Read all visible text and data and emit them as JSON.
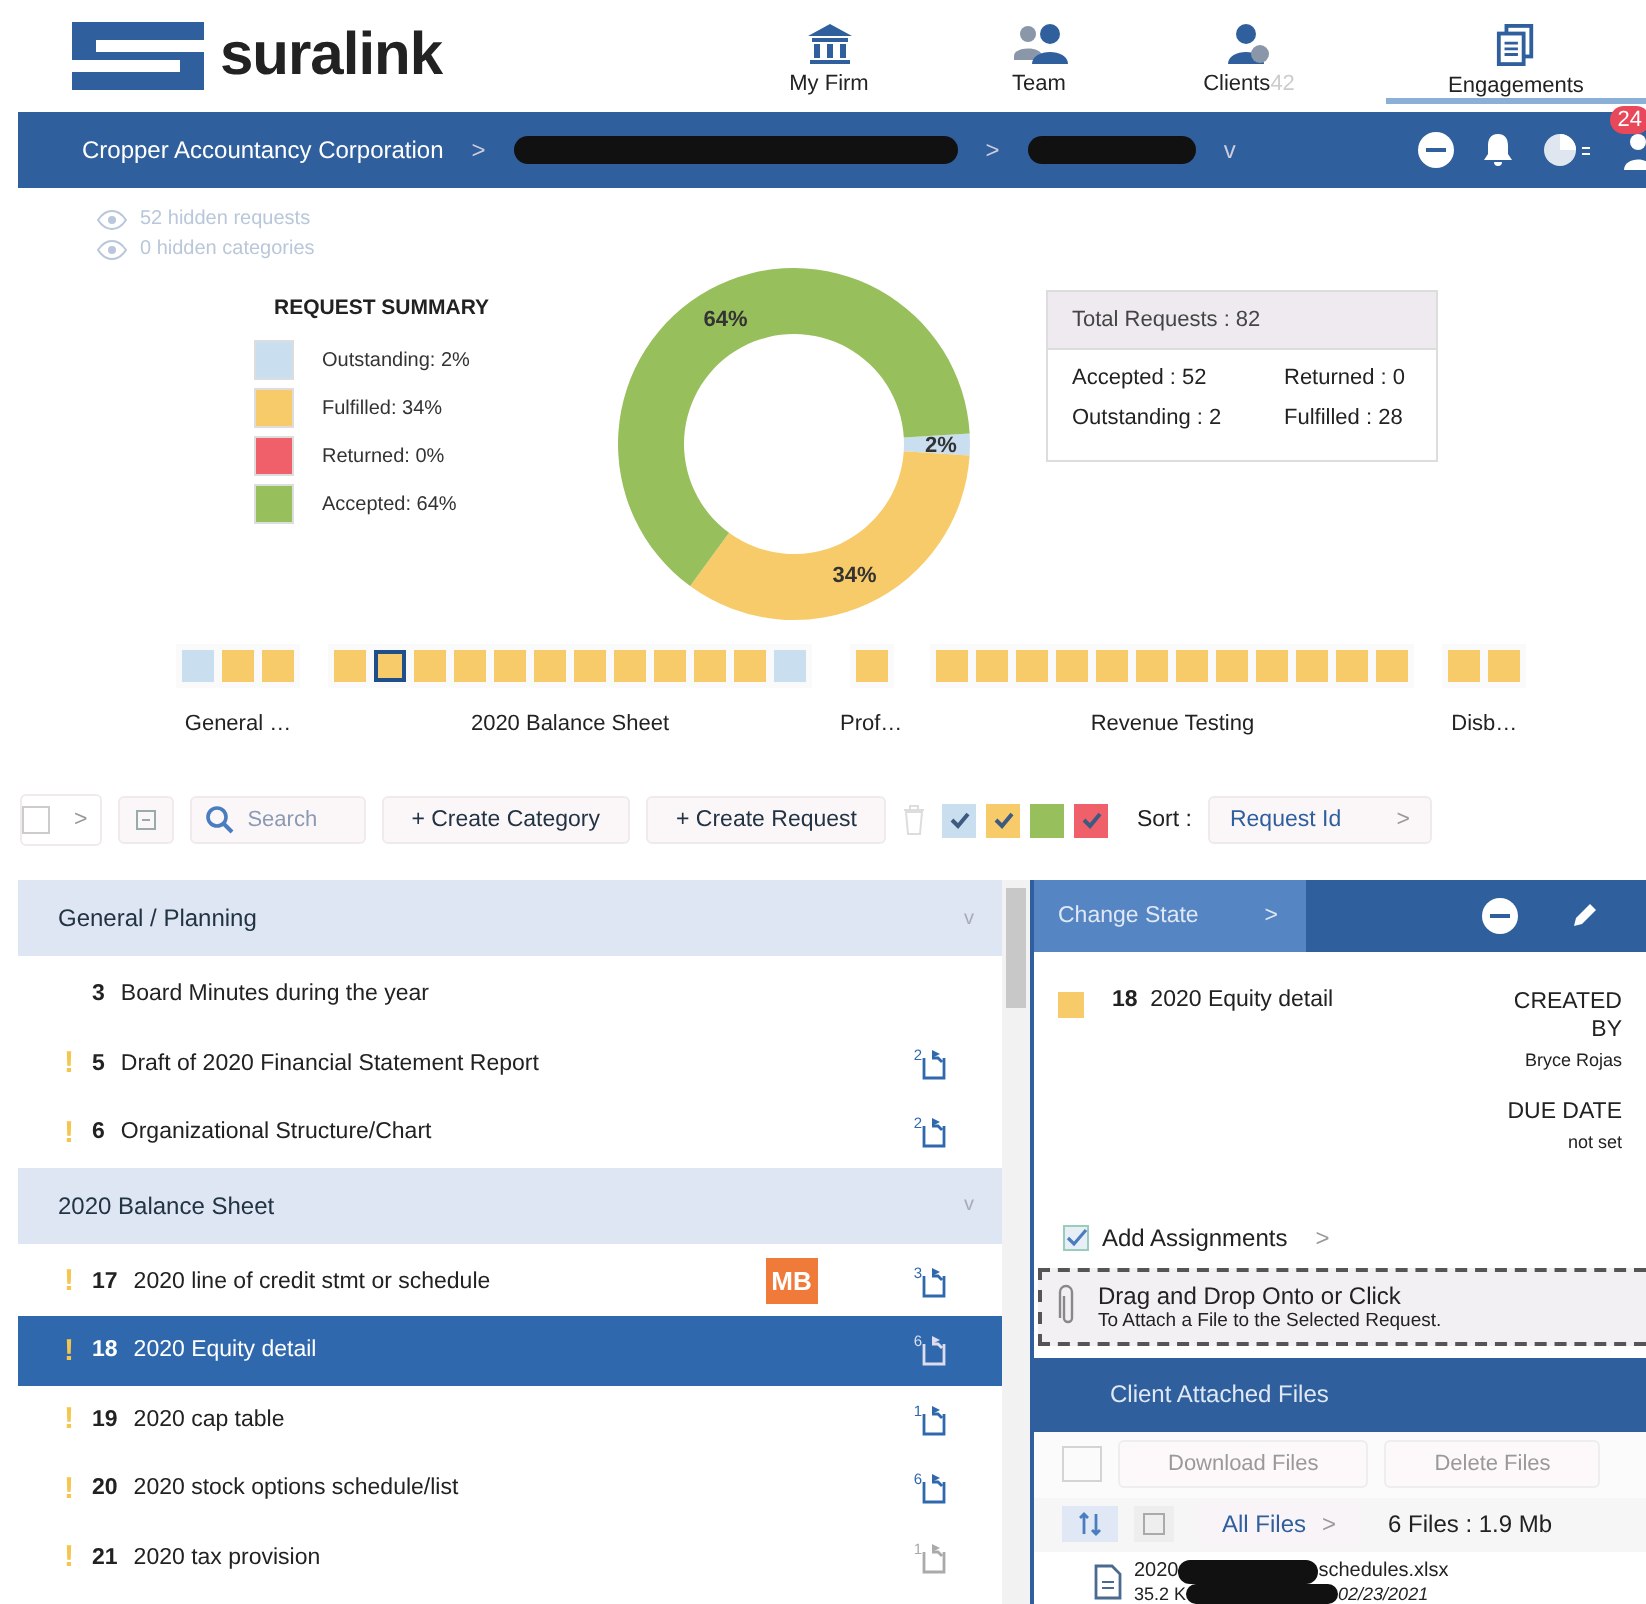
{
  "brand": {
    "name": "suralink"
  },
  "nav": [
    {
      "label": "My Firm",
      "selected": false
    },
    {
      "label": "Team",
      "selected": false
    },
    {
      "label": "Clients",
      "count": "42",
      "selected": false
    },
    {
      "label": "Engagements",
      "selected": true
    }
  ],
  "breadcrumb": {
    "firm": "Cropper Accountancy Corporation",
    "separators": [
      ">",
      ">"
    ],
    "dropdown": "v",
    "badge": "24"
  },
  "hidden": [
    "52 hidden requests",
    "0 hidden categories"
  ],
  "summary": {
    "title": "REQUEST SUMMARY",
    "legend": [
      {
        "kind": "outstanding",
        "color": "#c9dff0"
      },
      {
        "kind": "fulfilled",
        "color": "#f7cb69"
      },
      {
        "kind": "returned",
        "color": "#f0606b"
      },
      {
        "kind": "accepted",
        "color": "#97bf5c"
      }
    ],
    "chart_data": {
      "type": "donut",
      "categories": [
        "Outstanding: 2%",
        "Fulfilled: 34%",
        "Returned: 0%",
        "Accepted: 64%"
      ],
      "values": [
        2,
        34,
        0,
        64
      ],
      "value_labels": [
        "2%",
        "34%",
        null,
        "64%"
      ]
    },
    "totals": {
      "title": "Total Requests : 82",
      "cells": [
        "Accepted : 52",
        "Returned : 0",
        "Outstanding : 2",
        "Fulfilled : 28"
      ]
    }
  },
  "progress_groups": [
    {
      "label": "General …",
      "squares": [
        {
          "kind": "outstanding",
          "selected": false
        },
        {
          "kind": "fulfilled",
          "selected": false
        },
        {
          "kind": "fulfilled",
          "selected": false
        }
      ]
    },
    {
      "label": "2020 Balance Sheet",
      "squares": [
        {
          "kind": "fulfilled",
          "selected": false
        },
        {
          "kind": "fulfilled",
          "selected": true
        },
        {
          "kind": "fulfilled",
          "selected": false
        },
        {
          "kind": "fulfilled",
          "selected": false
        },
        {
          "kind": "fulfilled",
          "selected": false
        },
        {
          "kind": "fulfilled",
          "selected": false
        },
        {
          "kind": "fulfilled",
          "selected": false
        },
        {
          "kind": "fulfilled",
          "selected": false
        },
        {
          "kind": "fulfilled",
          "selected": false
        },
        {
          "kind": "fulfilled",
          "selected": false
        },
        {
          "kind": "fulfilled",
          "selected": false
        },
        {
          "kind": "outstanding",
          "selected": false
        }
      ]
    },
    {
      "label": "Prof…",
      "squares": [
        {
          "kind": "fulfilled",
          "selected": false
        }
      ]
    },
    {
      "label": "Revenue Testing",
      "squares": [
        {
          "kind": "fulfilled",
          "selected": false
        },
        {
          "kind": "fulfilled",
          "selected": false
        },
        {
          "kind": "fulfilled",
          "selected": false
        },
        {
          "kind": "fulfilled",
          "selected": false
        },
        {
          "kind": "fulfilled",
          "selected": false
        },
        {
          "kind": "fulfilled",
          "selected": false
        },
        {
          "kind": "fulfilled",
          "selected": false
        },
        {
          "kind": "fulfilled",
          "selected": false
        },
        {
          "kind": "fulfilled",
          "selected": false
        },
        {
          "kind": "fulfilled",
          "selected": false
        },
        {
          "kind": "fulfilled",
          "selected": false
        },
        {
          "kind": "fulfilled",
          "selected": false
        }
      ]
    },
    {
      "label": "Disb…",
      "squares": [
        {
          "kind": "fulfilled",
          "selected": false
        },
        {
          "kind": "fulfilled",
          "selected": false
        }
      ]
    }
  ],
  "toolbar": {
    "select_all": {
      "checked": false,
      "caret": ">"
    },
    "search": {
      "placeholder": "Search"
    },
    "buttons": [
      "+ Create Category",
      "+ Create Request"
    ],
    "filters": [
      {
        "kind": "outstanding",
        "checked": true
      },
      {
        "kind": "fulfilled",
        "checked": true
      },
      {
        "kind": "accepted",
        "checked": false
      },
      {
        "kind": "returned",
        "checked": true
      }
    ],
    "sort_label": "Sort :",
    "sort_value": "Request Id",
    "sort_caret": ">"
  },
  "categories": [
    {
      "title": "General / Planning",
      "toggle": "v",
      "requests": [
        {
          "number": "3",
          "title": "Board Minutes during the year",
          "selected": false
        },
        {
          "flag": "!",
          "number": "5",
          "title": "Draft of 2020 Financial Statement Report",
          "files": "2",
          "selected": false
        },
        {
          "flag": "!",
          "number": "6",
          "title": "Organizational Structure/Chart",
          "files": "2",
          "selected": false
        }
      ]
    },
    {
      "title": "2020 Balance Sheet",
      "toggle": "v",
      "requests": [
        {
          "flag": "!",
          "number": "17",
          "title": "2020 line of credit stmt or schedule",
          "assignee": "MB",
          "files": "3",
          "selected": false
        },
        {
          "flag": "!",
          "number": "18",
          "title": "2020 Equity detail",
          "files": "6",
          "selected": true
        },
        {
          "flag": "!",
          "number": "19",
          "title": "2020 cap table",
          "files": "1",
          "selected": false
        },
        {
          "flag": "!",
          "number": "20",
          "title": "2020 stock options schedule/list",
          "files": "6",
          "selected": false
        },
        {
          "flag": "!",
          "number": "21",
          "title": "2020 tax provision",
          "files": "1",
          "faint": true,
          "selected": false
        }
      ]
    }
  ],
  "detail": {
    "change_state": "Change State",
    "caret": ">",
    "kind": "fulfilled",
    "number": "18",
    "title": "2020 Equity detail",
    "created_label": [
      "CREATED",
      "BY"
    ],
    "created_by": "Bryce Rojas",
    "due_label": "DUE DATE",
    "due": "not set",
    "add_assignments": "Add Assignments",
    "add_caret": ">",
    "drop": [
      "Drag and Drop Onto or Click",
      "To Attach a File to the Selected Request."
    ],
    "files_title": "Client Attached Files",
    "files_checkbox": {
      "checked": false
    },
    "file_buttons": [
      "Download Files",
      "Delete Files"
    ],
    "filter": "All Files",
    "filter_caret": ">",
    "files_summary": "6 Files : 1.9 Mb",
    "file": {
      "name_start": "2020",
      "name_end": "schedules.xlsx",
      "size": "35.2 K",
      "date": "02/23/2021"
    }
  }
}
